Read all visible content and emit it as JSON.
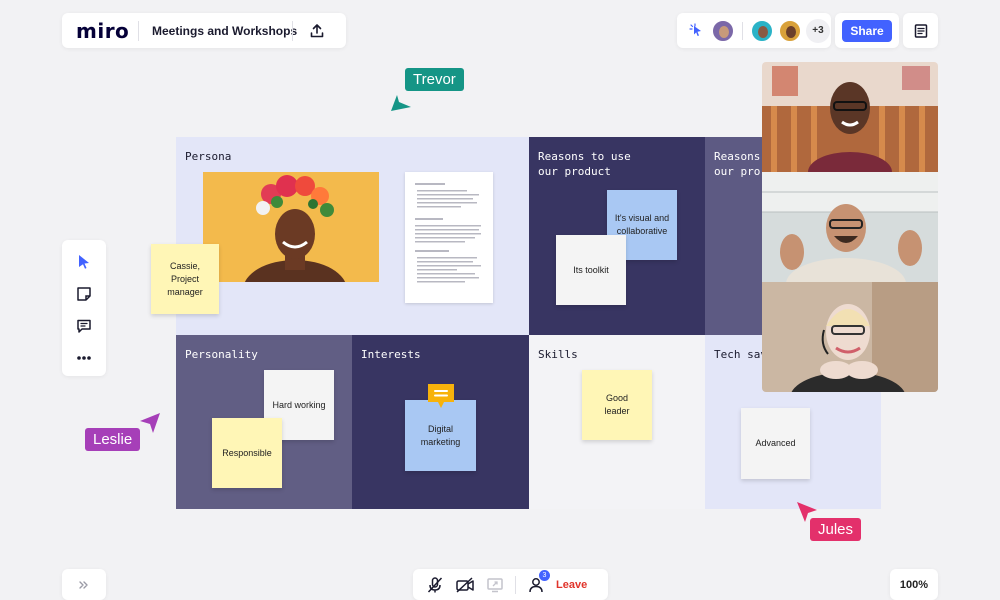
{
  "app": {
    "logo": "miro",
    "board_title": "Meetings and Workshops"
  },
  "header": {
    "collaborators": [
      {
        "name": "avatar-1",
        "color": "#7b68a8"
      },
      {
        "name": "avatar-2",
        "color": "#2bb3c7"
      },
      {
        "name": "avatar-3",
        "color": "#d9a13a"
      }
    ],
    "extra_count": "+3",
    "share_label": "Share"
  },
  "board": {
    "cells": [
      {
        "id": "persona",
        "label": "Persona",
        "bg": "#e3e6f8",
        "text": "#1a1a2e"
      },
      {
        "id": "reasons-use",
        "label": "Reasons to use\nour product",
        "bg": "#383562",
        "text": "#ffffff"
      },
      {
        "id": "reasons-other",
        "label": "Reasons\nour pro",
        "bg": "#5d5a83",
        "text": "#ffffff"
      },
      {
        "id": "personality",
        "label": "Personality",
        "bg": "#615e84",
        "text": "#ffffff"
      },
      {
        "id": "interests",
        "label": "Interests",
        "bg": "#383562",
        "text": "#ffffff"
      },
      {
        "id": "skills",
        "label": "Skills",
        "bg": "#f3f3f6",
        "text": "#1a1a2e"
      },
      {
        "id": "tech-savvy",
        "label": "Tech sav",
        "bg": "#e3e6f8",
        "text": "#1a1a2e"
      }
    ],
    "stickies": [
      {
        "id": "cassie",
        "text": "Cassie,\nProject\nmanager",
        "color": "#fff6b6"
      },
      {
        "id": "visual",
        "text": "It's visual and\ncollaborative",
        "color": "#a9c8f3"
      },
      {
        "id": "toolkit",
        "text": "Its toolkit",
        "color": "#f4f4f4"
      },
      {
        "id": "hardworking",
        "text": "Hard working",
        "color": "#f4f4f4"
      },
      {
        "id": "responsible",
        "text": "Responsible",
        "color": "#fff6b6"
      },
      {
        "id": "digital",
        "text": "Digital\nmarketing",
        "color": "#a9c8f3"
      },
      {
        "id": "goodleader",
        "text": "Good\nleader",
        "color": "#fff6b6"
      },
      {
        "id": "advanced",
        "text": "Advanced",
        "color": "#f4f4f4"
      }
    ]
  },
  "cursors": [
    {
      "name": "Trevor",
      "color": "#159586"
    },
    {
      "name": "Leslie",
      "color": "#a63fb8"
    },
    {
      "name": "Jules",
      "color": "#e3306b"
    }
  ],
  "call": {
    "participant_badge": "3",
    "leave_label": "Leave"
  },
  "zoom": {
    "level": "100%"
  },
  "colors": {
    "accent": "#4262ff",
    "leave": "#e0342b"
  }
}
